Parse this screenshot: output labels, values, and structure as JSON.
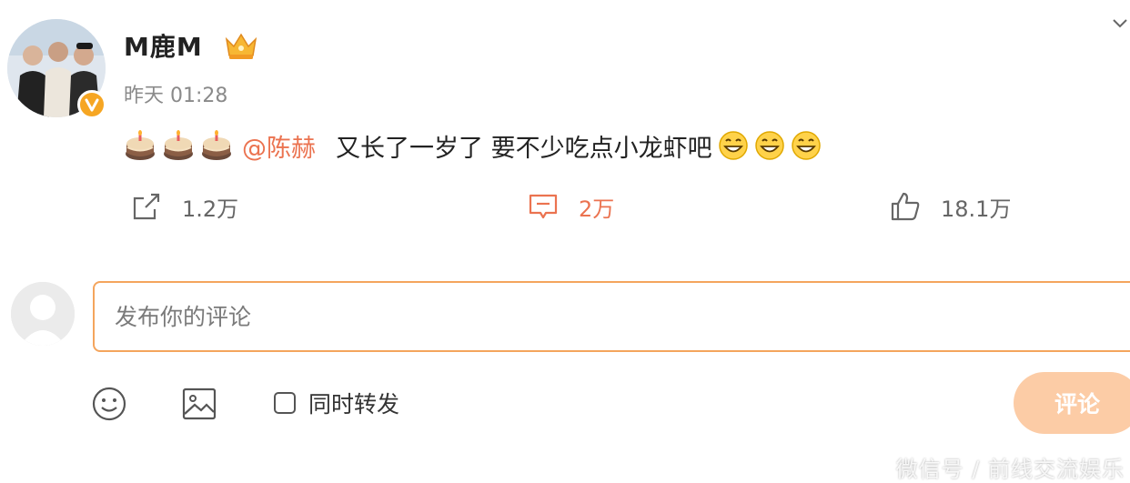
{
  "post": {
    "author": "M鹿M",
    "timestamp": "昨天 01:28",
    "mention": "@陈赫",
    "text": "又长了一岁了 要不少吃点小龙虾吧",
    "cake_emojis": 3,
    "grin_emojis": 3
  },
  "actions": {
    "forward_count": "1.2万",
    "comment_count": "2万",
    "like_count": "18.1万"
  },
  "composer": {
    "placeholder": "发布你的评论",
    "forward_option_label": "同时转发",
    "submit_label": "评论"
  },
  "watermark": "微信号 / 前线交流娱乐",
  "colors": {
    "accent": "#eb7350",
    "input_border": "#f4a55d",
    "submit_bg": "#fccca6",
    "muted": "#8a8a8a"
  },
  "icons": [
    "verified-badge-icon",
    "crown-icon",
    "chevron-down-icon",
    "cake-icon",
    "grin-icon",
    "forward-icon",
    "comment-icon",
    "like-icon",
    "emoji-icon",
    "image-icon"
  ]
}
